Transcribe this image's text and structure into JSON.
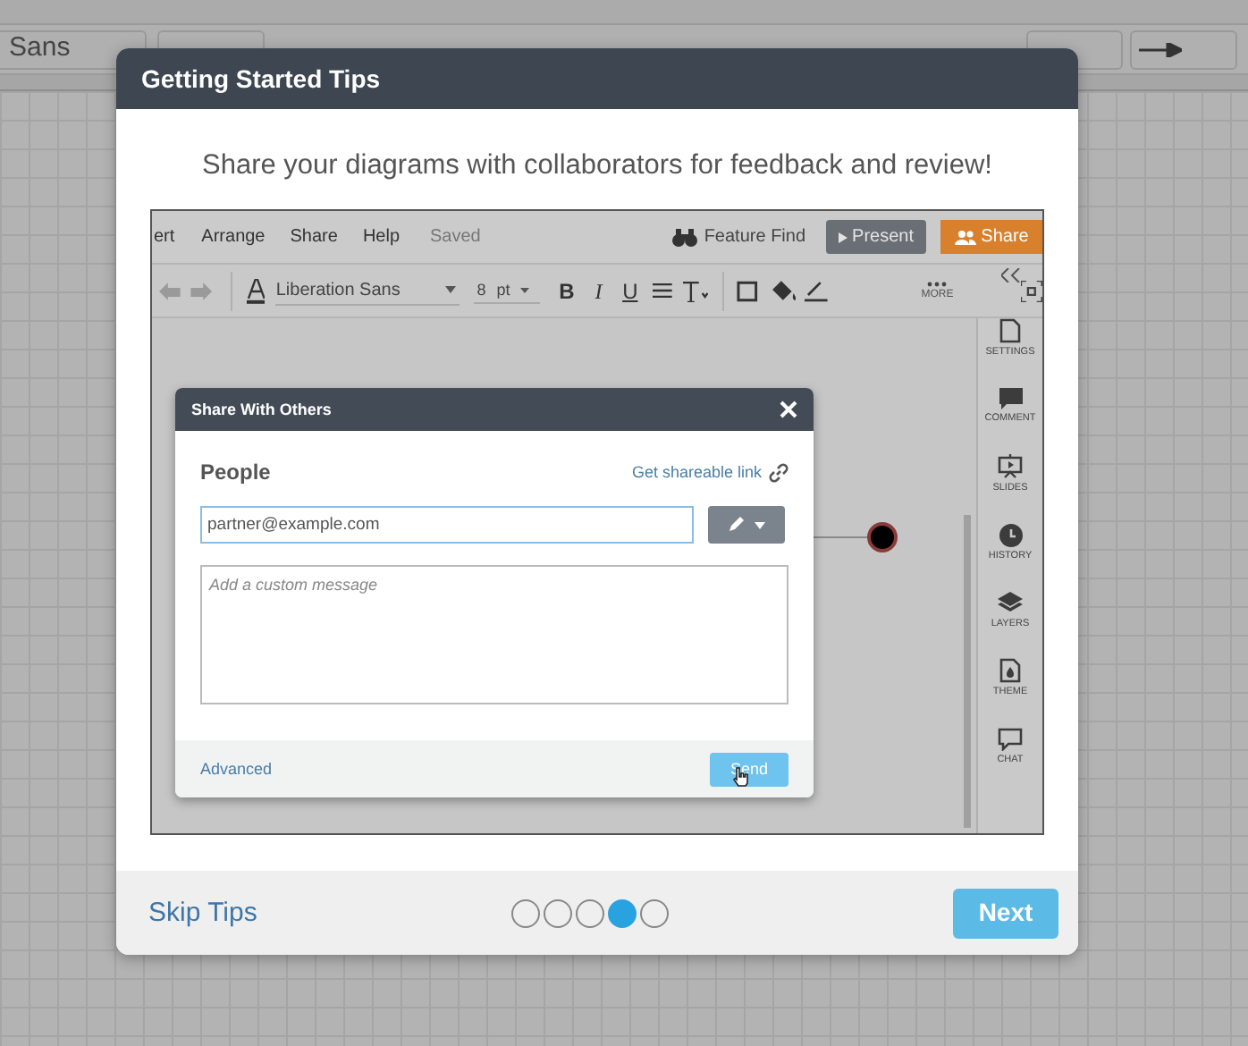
{
  "background_app": {
    "font_field": "Sans"
  },
  "modal": {
    "title": "Getting Started Tips",
    "message": "Share your diagrams with collaborators for feedback and review!",
    "screenshot": {
      "menu": [
        "ert",
        "Arrange",
        "Share",
        "Help"
      ],
      "status": "Saved",
      "feature_find": "Feature Find",
      "present_button": "Present",
      "share_button": "Share",
      "toolbar": {
        "font": "Liberation Sans",
        "size": "8",
        "unit": "pt",
        "format_buttons": [
          "B",
          "I",
          "U"
        ],
        "more": "MORE"
      },
      "sidebar": [
        {
          "kind": "document",
          "label": "SETTINGS"
        },
        {
          "kind": "comment",
          "label": "COMMENT"
        },
        {
          "kind": "slides",
          "label": "SLIDES"
        },
        {
          "kind": "clock",
          "label": "HISTORY"
        },
        {
          "kind": "layers",
          "label": "LAYERS"
        },
        {
          "kind": "theme",
          "label": "THEME"
        },
        {
          "kind": "chat",
          "label": "CHAT"
        }
      ],
      "share_dialog": {
        "title": "Share With Others",
        "section": "People",
        "link": "Get shareable link",
        "email": "partner@example.com",
        "message_placeholder": "Add a custom message",
        "advanced": "Advanced",
        "send": "Send"
      }
    },
    "pager": [
      {
        "selected": false
      },
      {
        "selected": false
      },
      {
        "selected": false
      },
      {
        "selected": true
      },
      {
        "selected": false
      }
    ],
    "skip": "Skip Tips",
    "next": "Next"
  }
}
